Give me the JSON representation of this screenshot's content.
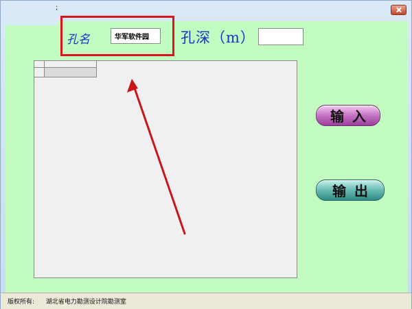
{
  "window": {
    "title": "",
    "title_marker": ";"
  },
  "form": {
    "hole_name_label": "孔名",
    "hole_name_value": "华军软件园",
    "hole_depth_label": "孔深（m）",
    "hole_depth_value": ""
  },
  "buttons": {
    "input_label": "输入",
    "output_label": "输出"
  },
  "status": {
    "copyright_label": "版权所有:",
    "organization": "湖北省电力勘测设计院勘测室"
  },
  "colors": {
    "client_bg": "#c2fcc1",
    "label_blue": "#1633c4",
    "highlight_red": "#d9161f",
    "arrow_red": "#c8141b"
  },
  "annotations": {
    "highlight": "red-box-around-hole-name",
    "arrow": "red-arrow-pointing-to-hole-name"
  }
}
